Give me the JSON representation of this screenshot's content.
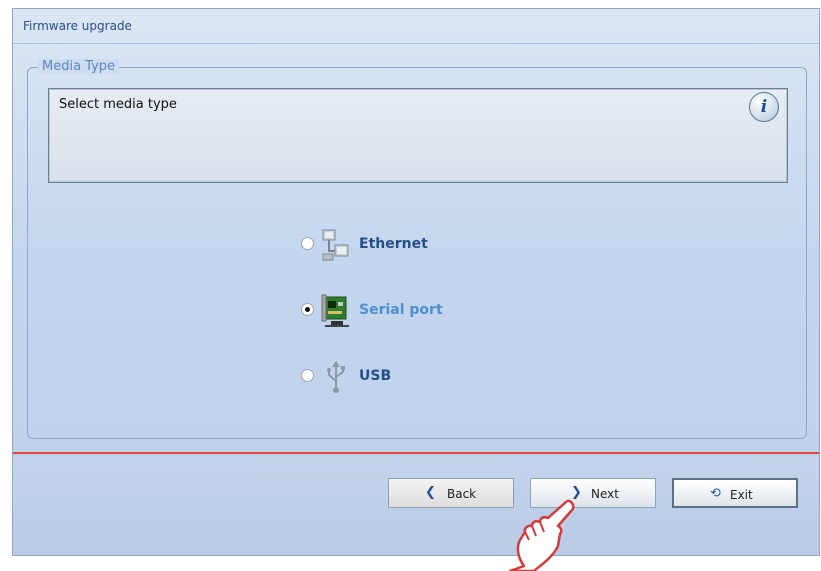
{
  "window": {
    "title": "Firmware upgrade"
  },
  "media_group": {
    "legend": "Media Type",
    "info_text": "Select media type",
    "info_icon": "info-icon"
  },
  "options": [
    {
      "label": "Ethernet",
      "icon": "ethernet-network-icon",
      "selected": false
    },
    {
      "label": "Serial port",
      "icon": "serial-card-icon",
      "selected": true
    },
    {
      "label": "USB",
      "icon": "usb-icon",
      "selected": false
    }
  ],
  "buttons": {
    "back": "Back",
    "next": "Next",
    "exit": "Exit"
  },
  "colors": {
    "separator": "#e34242",
    "selected_label": "#4d8fd1",
    "label": "#244f8a"
  }
}
